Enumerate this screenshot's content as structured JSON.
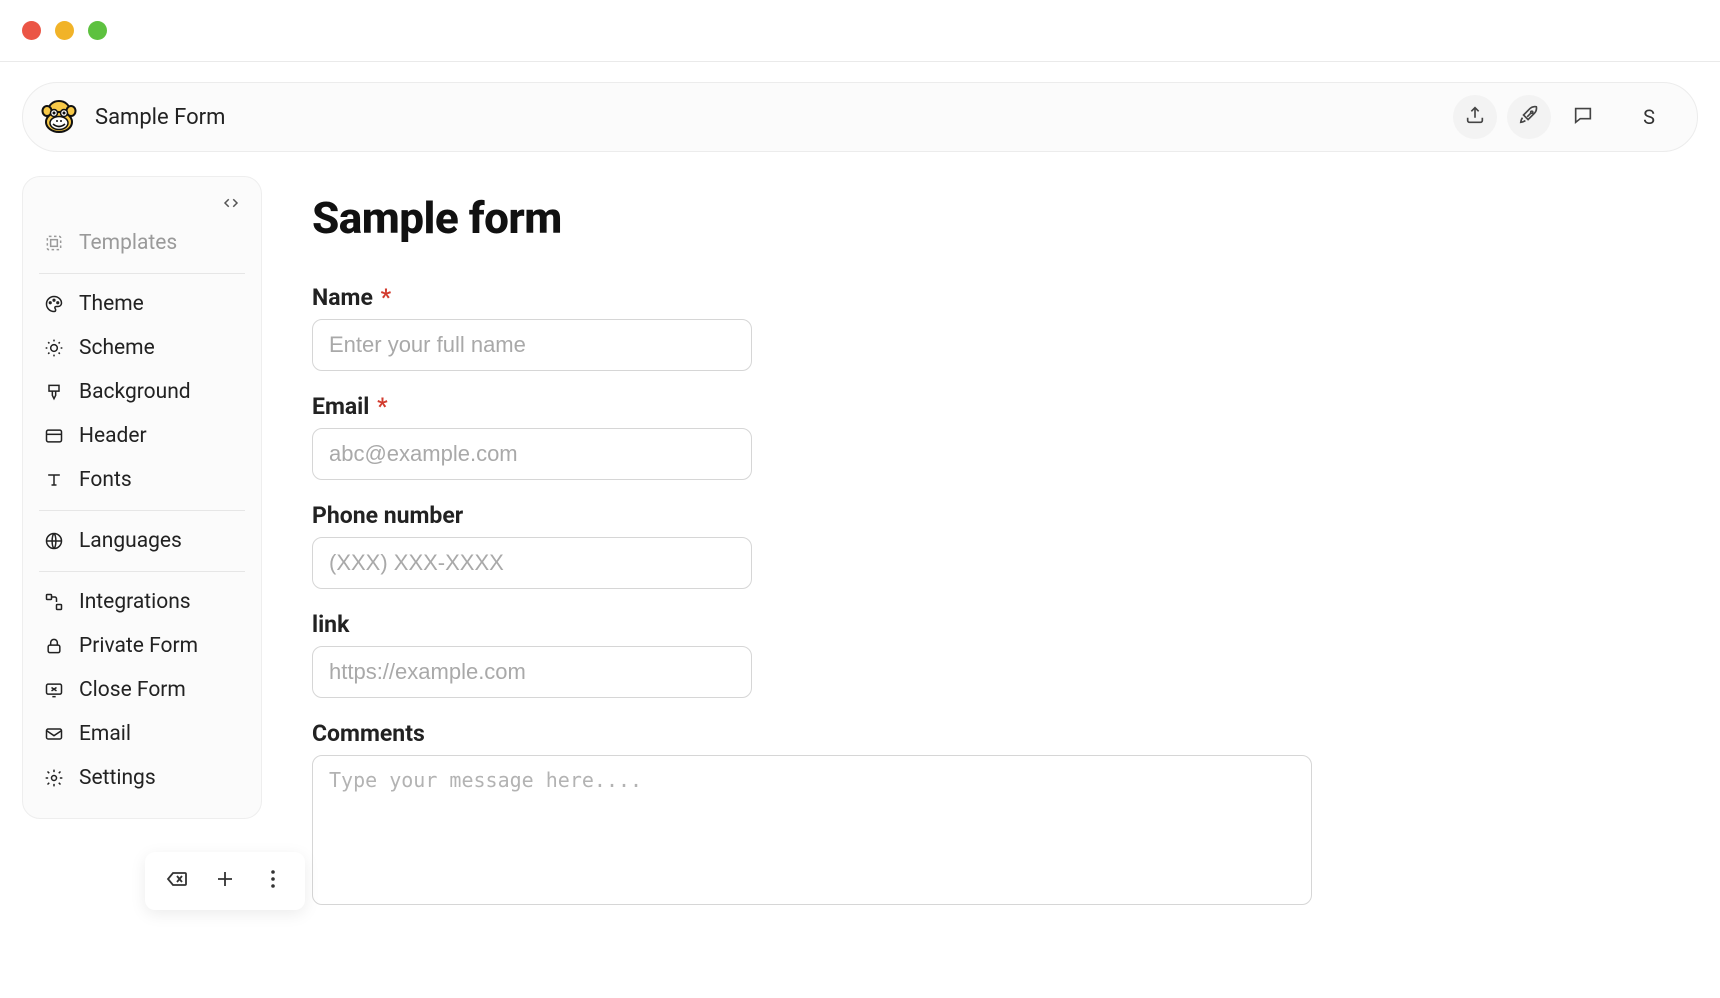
{
  "header": {
    "form_name": "Sample Form",
    "avatar_letter": "S"
  },
  "sidebar": {
    "templates_label": "Templates",
    "theme_label": "Theme",
    "scheme_label": "Scheme",
    "background_label": "Background",
    "header_label": "Header",
    "fonts_label": "Fonts",
    "languages_label": "Languages",
    "integrations_label": "Integrations",
    "private_form_label": "Private Form",
    "close_form_label": "Close Form",
    "email_label": "Email",
    "settings_label": "Settings"
  },
  "form": {
    "title": "Sample form",
    "fields": {
      "name": {
        "label": "Name",
        "required": true,
        "placeholder": "Enter your full name"
      },
      "email": {
        "label": "Email",
        "required": true,
        "placeholder": "abc@example.com"
      },
      "phone": {
        "label": "Phone number",
        "required": false,
        "placeholder": "(XXX) XXX-XXXX"
      },
      "link": {
        "label": "link",
        "required": false,
        "placeholder": "https://example.com"
      },
      "comments": {
        "label": "Comments",
        "required": false,
        "placeholder": "Type your message here...."
      }
    }
  }
}
